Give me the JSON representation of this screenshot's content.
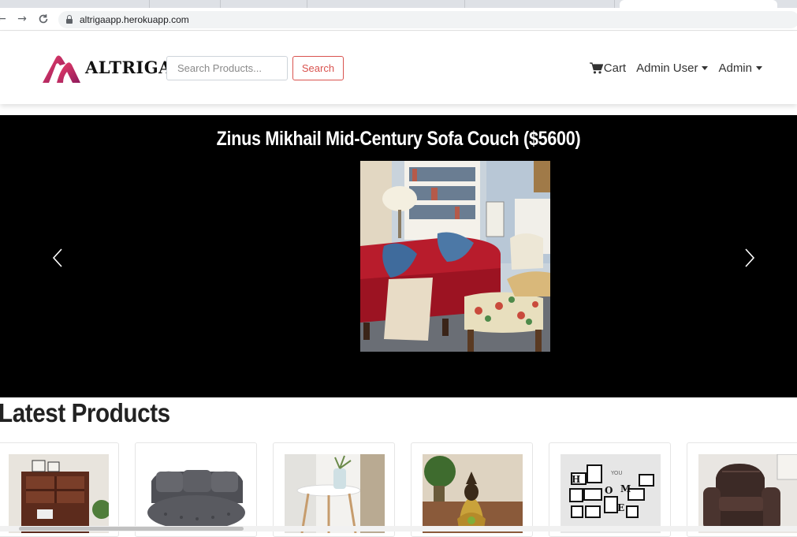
{
  "browser": {
    "url": "altrigaapp.herokuapp.com",
    "nav_icons": [
      "back-arrow-icon",
      "forward-arrow-icon",
      "reload-icon",
      "lock-icon"
    ]
  },
  "header": {
    "brand": "ALTRIGA",
    "search_placeholder": "Search Products...",
    "search_button": "Search",
    "nav": {
      "cart": "Cart",
      "user_menu": "Admin User",
      "admin_menu": "Admin"
    }
  },
  "carousel": {
    "caption": "Zinus Mikhail Mid-Century Sofa Couch ($5600)",
    "prev_icon": "chevron-left-icon",
    "next_icon": "chevron-right-icon"
  },
  "latest": {
    "title": "Latest Products",
    "products": [
      {
        "image": "wooden-desk-hutch"
      },
      {
        "image": "grey-tufted-round-chair"
      },
      {
        "image": "white-side-table"
      },
      {
        "image": "buddha-statue"
      },
      {
        "image": "home-photo-frame-collage"
      },
      {
        "image": "brown-leather-recliner"
      }
    ]
  },
  "colors": {
    "accent": "#d9534f",
    "logo_gradient": [
      "#e8315b",
      "#9b1b5a"
    ],
    "carousel_bg": "#000000"
  }
}
